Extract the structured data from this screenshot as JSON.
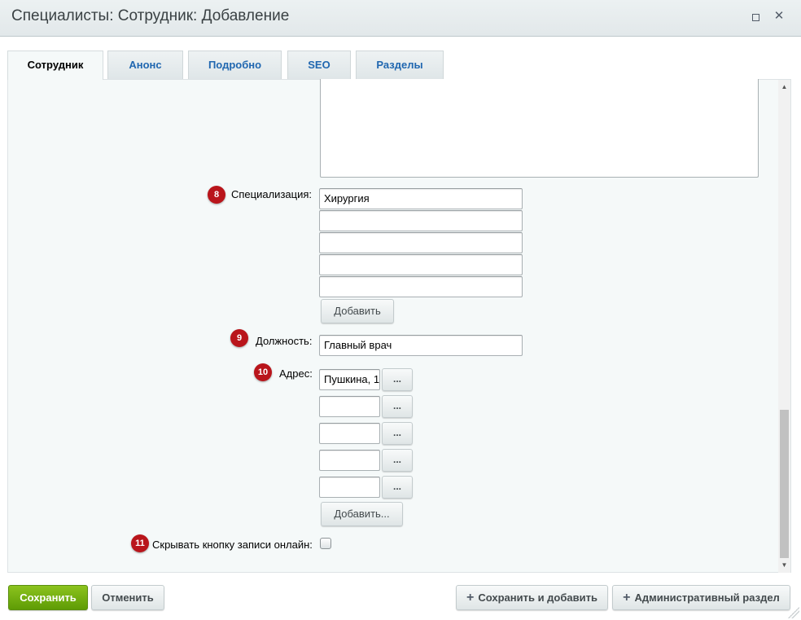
{
  "dialog": {
    "title": "Специалисты: Сотрудник: Добавление"
  },
  "tabs": [
    {
      "label": "Сотрудник",
      "active": true
    },
    {
      "label": "Анонс",
      "active": false
    },
    {
      "label": "Подробно",
      "active": false
    },
    {
      "label": "SEO",
      "active": false
    },
    {
      "label": "Разделы",
      "active": false
    }
  ],
  "form": {
    "specialization": {
      "badge": "8",
      "label": "Специализация:",
      "values": [
        "Хирургия",
        "",
        "",
        "",
        ""
      ],
      "add_label": "Добавить"
    },
    "position": {
      "badge": "9",
      "label": "Должность:",
      "value": "Главный врач"
    },
    "address": {
      "badge": "10",
      "label": "Адрес:",
      "values": [
        "Пушкина, 1",
        "",
        "",
        "",
        ""
      ],
      "browse_label": "...",
      "add_label": "Добавить..."
    },
    "hide_booking": {
      "badge": "11",
      "label": "Скрывать кнопку записи онлайн:",
      "checked": false
    }
  },
  "footer": {
    "save_label": "Сохранить",
    "cancel_label": "Отменить",
    "save_add_label": "Сохранить и добавить",
    "admin_label": "Административный раздел"
  },
  "icons": {
    "maximize": "maximize-icon",
    "close": "close-icon",
    "plus": "plus-icon"
  },
  "colors": {
    "badge": "#b9151b",
    "save_button": "#6ba50d",
    "tab_link": "#2067b0"
  }
}
